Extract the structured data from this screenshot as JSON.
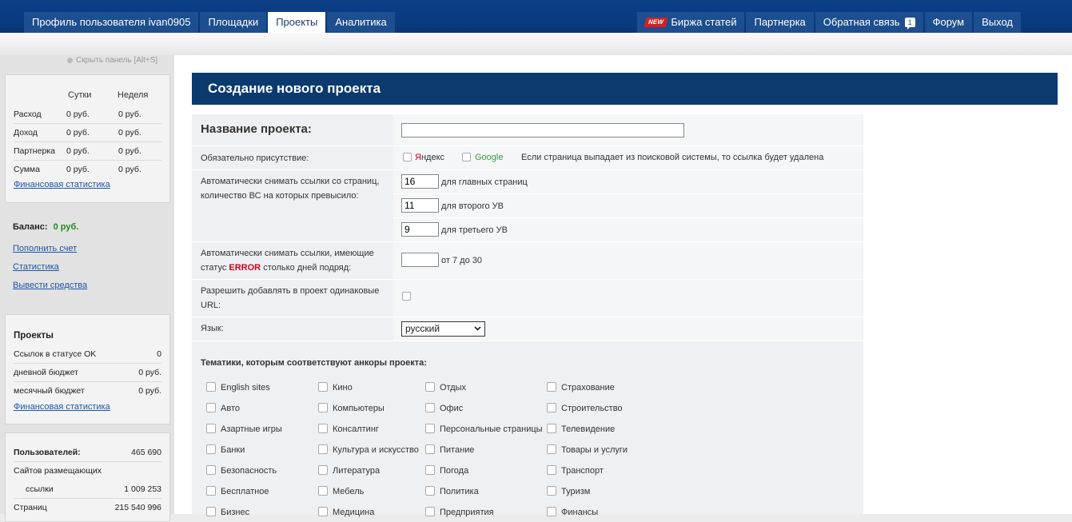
{
  "nav": {
    "left_tabs": [
      "Профиль пользователя ivan0905",
      "Площадки",
      "Проекты",
      "Аналитика"
    ],
    "right": {
      "new_badge": "NEW",
      "articles": "Биржа статей",
      "partner": "Партнерка",
      "feedback": "Обратная связь",
      "feedback_count": "1",
      "forum": "Форум",
      "logout": "Выход"
    }
  },
  "sidebar": {
    "hide_panel": "Скрыть панель [Alt+S]",
    "stats": {
      "col_day": "Сутки",
      "col_week": "Неделя",
      "rows": [
        {
          "label": "Расход",
          "day": "0 руб.",
          "week": "0 руб."
        },
        {
          "label": "Доход",
          "day": "0 руб.",
          "week": "0 руб."
        },
        {
          "label": "Партнерка",
          "day": "0 руб.",
          "week": "0 руб."
        },
        {
          "label": "Сумма",
          "day": "0 руб.",
          "week": "0 руб."
        }
      ],
      "link": "Финансовая статистика"
    },
    "balance_label": "Баланс:",
    "balance_value": "0 руб.",
    "links": [
      "Пополнить счет",
      "Статистика",
      "Вывести средства"
    ],
    "projects": {
      "title": "Проекты",
      "rows": [
        {
          "label": "Ссылок в статусе OK",
          "value": "0"
        },
        {
          "label": "дневной бюджет",
          "value": "0 руб."
        },
        {
          "label": "месячный бюджет",
          "value": "0 руб."
        }
      ],
      "link": "Финансовая статистика"
    },
    "users": {
      "title": "Пользователей:",
      "title_value": "465 690",
      "sites_label": "Сайтов размещающих",
      "links_label": "ссылки",
      "links_value": "1 009 253",
      "pages_label": "Страниц",
      "pages_value": "215 540 996"
    }
  },
  "form": {
    "title": "Создание нового проекта",
    "name_label": "Название проекта:",
    "name_value": "",
    "presence_label": "Обязательно присутствие:",
    "yandex_first": "Я",
    "yandex_rest": "ндекс",
    "google": "Google",
    "presence_note": "Если страница выпадает из поисковой системы, то ссылка будет удалена",
    "auto_remove_label_1": "Автоматически снимать ссылки со страниц,",
    "auto_remove_label_2": "количество ВС на которых превысило:",
    "level1_value": "16",
    "level1_label": "для главных страниц",
    "level2_value": "11",
    "level2_label": "для второго УВ",
    "level3_value": "9",
    "level3_label": "для третьего УВ",
    "error_label_1": "Автоматически снимать ссылки, имеющие",
    "error_label_2a": "статус",
    "error_word": "ERROR",
    "error_label_2b": "столько дней подряд:",
    "error_days_value": "",
    "error_range": "от 7 до 30",
    "dup_label_1": "Разрешить добавлять в проект одинаковые",
    "dup_label_2": "URL:",
    "lang_label": "Язык:",
    "lang_value": "русский",
    "topics_title": "Тематики, которым соответствуют анкоры проекта:",
    "topics": [
      [
        "English sites",
        "Авто",
        "Азартные игры",
        "Банки",
        "Безопасность",
        "Бесплатное",
        "Бизнес"
      ],
      [
        "Кино",
        "Компьютеры",
        "Консалтинг",
        "Культура и искусство",
        "Литература",
        "Мебель",
        "Медицина"
      ],
      [
        "Отдых",
        "Офис",
        "Персональные страницы",
        "Питание",
        "Погода",
        "Политика",
        "Предприятия"
      ],
      [
        "Страхование",
        "Строительство",
        "Телевидение",
        "Товары и услуги",
        "Транспорт",
        "Туризм",
        "Финансы"
      ]
    ]
  }
}
